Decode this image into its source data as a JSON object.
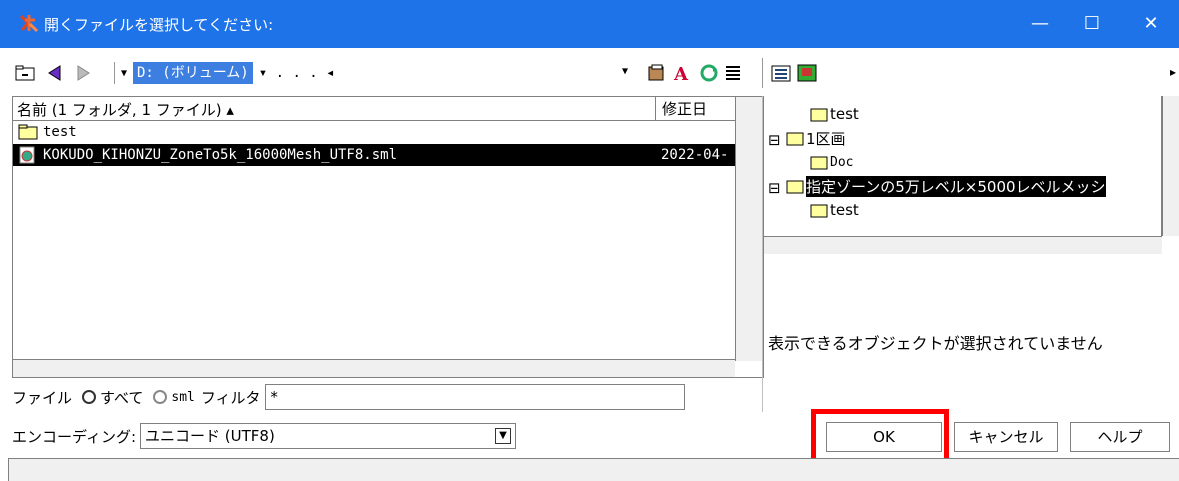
{
  "window": {
    "title": "開くファイルを選択してください:",
    "minimize_glyph": "—",
    "maximize_glyph": "☐",
    "close_glyph": "✕",
    "accent": "#1e73e8"
  },
  "toolbar": {
    "volume": "D: (ボリューム)",
    "path_rest": "▾ . . . ◂",
    "icons": [
      "folder-up-icon",
      "back-icon",
      "forward-icon",
      "open-folder-icon",
      "font-icon",
      "refresh-icon",
      "list-icon",
      "details-icon",
      "image-icon"
    ]
  },
  "filelist": {
    "header_name": "名前 (1 フォルダ, 1 ファイル) ▴",
    "header_date": "修正日",
    "rows": [
      {
        "name": "test",
        "date": "",
        "selected": false,
        "icon": "folder-icon"
      },
      {
        "name": "KOKUDO_KIHONZU_ZoneTo5k_16000Mesh_UTF8.sml",
        "date": "2022-04-",
        "selected": true,
        "icon": "sml-file-icon"
      }
    ]
  },
  "tree": {
    "rows": [
      {
        "label": "test",
        "expander": "",
        "selected": false
      },
      {
        "label": "1区画",
        "expander": "⊟",
        "selected": false
      },
      {
        "label": "Doc",
        "expander": "",
        "selected": false
      },
      {
        "label": "指定ゾーンの5万レベル×5000レベルメッシ",
        "expander": "⊟",
        "selected": true
      },
      {
        "label": "test",
        "expander": "",
        "selected": false
      }
    ],
    "empty_message": "表示できるオブジェクトが選択されていません"
  },
  "filter": {
    "label": "ファイル",
    "option_all": "すべて",
    "option_sml": "sml",
    "filter_label": "フィルタ",
    "value": "*"
  },
  "encoding": {
    "label": "エンコーディング:",
    "value": "ユニコード (UTF8)"
  },
  "buttons": {
    "ok": "OK",
    "cancel": "キャンセル",
    "help": "ヘルプ"
  }
}
